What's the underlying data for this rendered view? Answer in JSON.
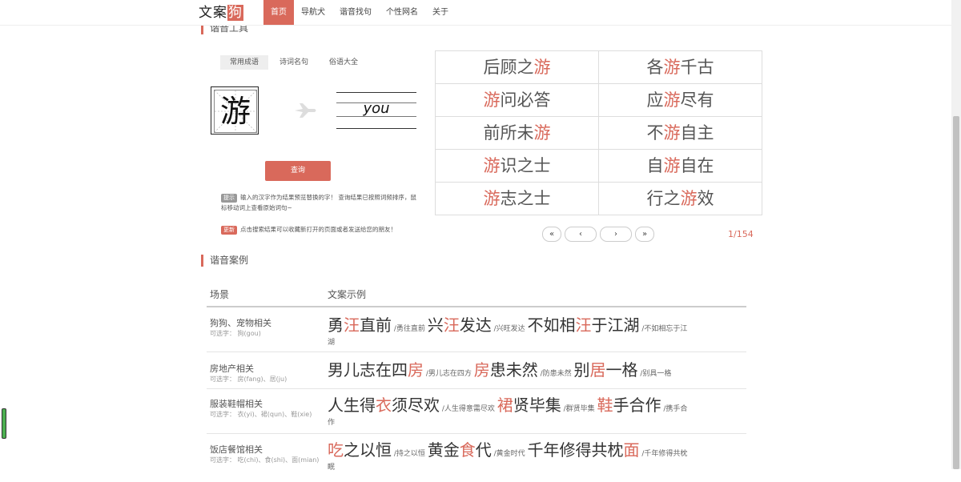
{
  "header": {
    "logo_main": "文案",
    "logo_accent": "狗",
    "nav": [
      "首页",
      "导航犬",
      "谐音找句",
      "个性网名",
      "关于"
    ]
  },
  "tool": {
    "section_title": "谐音工具",
    "tabs": [
      "常用成语",
      "诗词名句",
      "俗语大全"
    ],
    "input_char": "游",
    "pinyin": "you",
    "query_label": "查询",
    "tip_badge": "提示",
    "tip_text": "输入的汉字作为结果预览替换的字！ 查询结果已按照词频排序，鼠标移动词上查看原始词句~",
    "update_badge": "更新",
    "update_text": "点击搜索结果可以收藏新打开的页面或者发送给您的朋友！"
  },
  "results": [
    {
      "pre": "后顾之",
      "hl": "游",
      "post": ""
    },
    {
      "pre": "各",
      "hl": "游",
      "post": "千古"
    },
    {
      "pre": "",
      "hl": "游",
      "post": "问必答"
    },
    {
      "pre": "应",
      "hl": "游",
      "post": "尽有"
    },
    {
      "pre": "前所未",
      "hl": "游",
      "post": ""
    },
    {
      "pre": "不",
      "hl": "游",
      "post": "自主"
    },
    {
      "pre": "",
      "hl": "游",
      "post": "识之士"
    },
    {
      "pre": "自",
      "hl": "游",
      "post": "自在"
    },
    {
      "pre": "",
      "hl": "游",
      "post": "志之士"
    },
    {
      "pre": "行之",
      "hl": "游",
      "post": "效"
    }
  ],
  "pagination": {
    "first": "«",
    "prev": "‹",
    "next": "›",
    "last": "»",
    "page_info": "1/154"
  },
  "cases": {
    "section_title": "谐音案例",
    "col_scene": "场景",
    "col_example": "文案示例",
    "rows": [
      {
        "scene": "狗狗、宠物相关",
        "alt": "可选字： 狗(gou)",
        "examples": [
          {
            "pre": "勇",
            "hl": "汪",
            "post": "直前",
            "orig": " /勇往直前 "
          },
          {
            "pre": "兴",
            "hl": "汪",
            "post": "发达",
            "orig": " /兴旺发达 "
          },
          {
            "pre": "不如相",
            "hl": "汪",
            "post": "于江湖",
            "orig": " /不如相忘于江"
          }
        ],
        "tail": "湖"
      },
      {
        "scene": "房地产相关",
        "alt": "可选字： 房(fang)、居(ju)",
        "examples": [
          {
            "pre": "男儿志在四",
            "hl": "房",
            "post": "",
            "orig": " /男儿志在四方 "
          },
          {
            "pre": "",
            "hl": "房",
            "post": "患未然",
            "orig": " /防患未然 "
          },
          {
            "pre": "别",
            "hl": "居",
            "post": "一格",
            "orig": " /别具一格"
          }
        ],
        "tail": ""
      },
      {
        "scene": "服装鞋帽相关",
        "alt": "可选字： 衣(yi)、裙(qun)、鞋(xie)",
        "examples": [
          {
            "pre": "人生得",
            "hl": "衣",
            "post": "须尽欢",
            "orig": " /人生得意需尽欢 "
          },
          {
            "pre": "",
            "hl": "裙",
            "post": "贤毕集",
            "orig": " /群贤毕集 "
          },
          {
            "pre": "",
            "hl": "鞋",
            "post": "手合作",
            "orig": " /携手合"
          }
        ],
        "tail": "作"
      },
      {
        "scene": "饭店餐馆相关",
        "alt": "可选字： 吃(chi)、食(shi)、面(mian)",
        "examples": [
          {
            "pre": "",
            "hl": "吃",
            "post": "之以恒",
            "orig": " /持之以恒 "
          },
          {
            "pre": "黄金",
            "hl": "食",
            "post": "代",
            "orig": " /黄金时代 "
          },
          {
            "pre": "千年修得共枕",
            "hl": "面",
            "post": "",
            "orig": " /千年修得共枕"
          }
        ],
        "tail": "眠"
      }
    ]
  },
  "colors": {
    "accent": "#d9695b"
  }
}
